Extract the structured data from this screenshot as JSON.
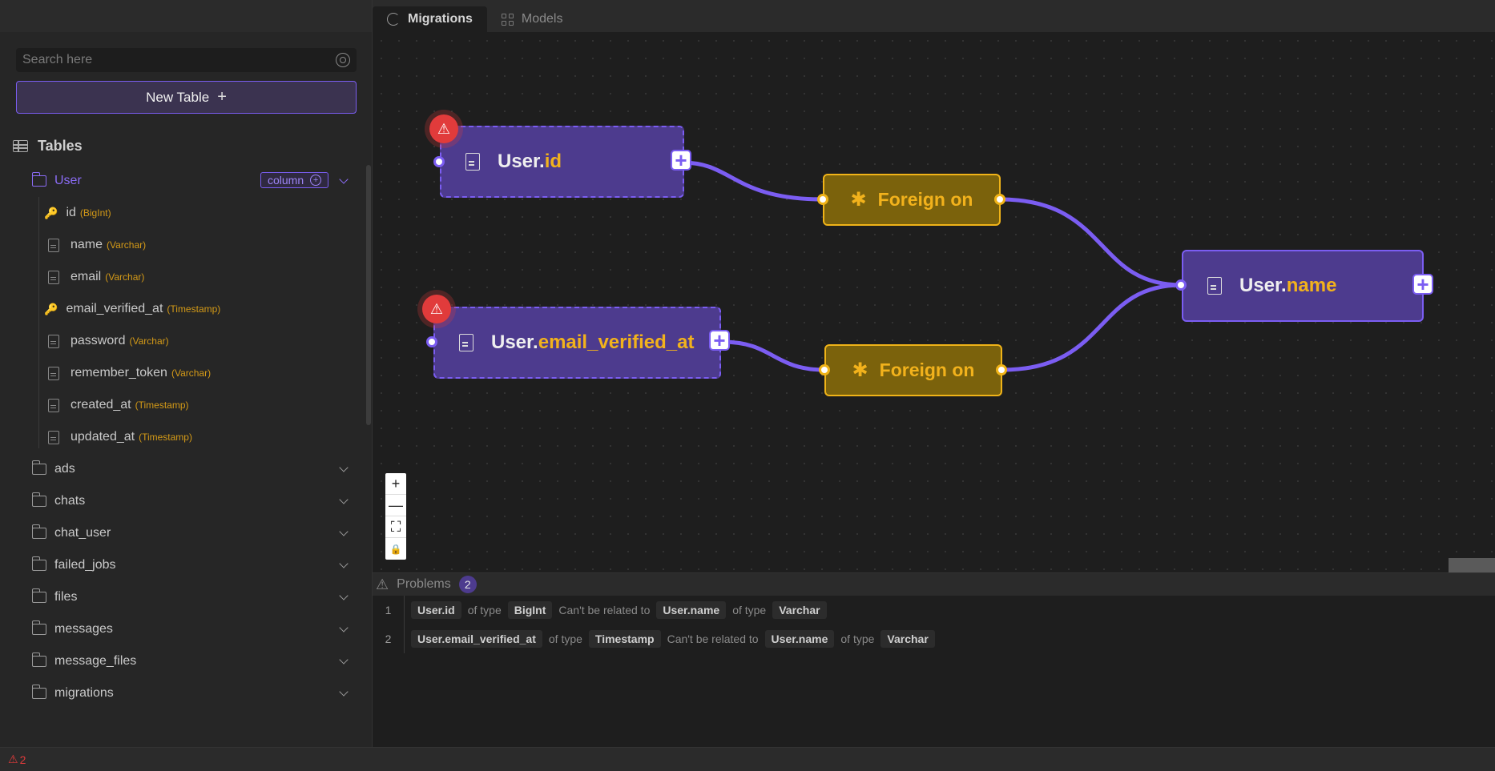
{
  "sidebar": {
    "search_placeholder": "Search here",
    "new_table_label": "New Table",
    "tables_header": "Tables",
    "active_table": {
      "name": "User",
      "column_pill": "column",
      "columns": [
        {
          "name": "id",
          "type": "(BigInt)",
          "icon": "key-icon-gold"
        },
        {
          "name": "name",
          "type": "(Varchar)",
          "icon": "document-icon"
        },
        {
          "name": "email",
          "type": "(Varchar)",
          "icon": "document-icon"
        },
        {
          "name": "email_verified_at",
          "type": "(Timestamp)",
          "icon": "key-icon-purple"
        },
        {
          "name": "password",
          "type": "(Varchar)",
          "icon": "document-icon"
        },
        {
          "name": "remember_token",
          "type": "(Varchar)",
          "icon": "document-icon"
        },
        {
          "name": "created_at",
          "type": "(Timestamp)",
          "icon": "document-icon"
        },
        {
          "name": "updated_at",
          "type": "(Timestamp)",
          "icon": "document-icon"
        }
      ]
    },
    "tables": [
      "ads",
      "chats",
      "chat_user",
      "failed_jobs",
      "files",
      "messages",
      "message_files",
      "migrations"
    ]
  },
  "tabs": [
    {
      "label": "Migrations",
      "active": true,
      "icon": "refresh-icon"
    },
    {
      "label": "Models",
      "active": false,
      "icon": "grid-icon"
    }
  ],
  "canvas": {
    "nodes": {
      "user_id": {
        "prefix": "User.",
        "field": "id"
      },
      "user_email_verified_at": {
        "prefix": "User.",
        "field": "email_verified_at"
      },
      "user_name": {
        "prefix": "User.",
        "field": "name"
      },
      "foreign_1": {
        "label": "Foreign on"
      },
      "foreign_2": {
        "label": "Foreign on"
      }
    },
    "warning_icon": "warning-triangle-icon",
    "edge_color": "#7b5df2",
    "field_node_color": "#4d3b8e",
    "foreign_node_color": "#7b620c",
    "accent_color": "#f2b21c"
  },
  "zoom_controls": [
    "zoom-in",
    "zoom-out",
    "fit-view",
    "lock"
  ],
  "problems": {
    "title": "Problems",
    "count": "2",
    "rows": [
      {
        "num": "1",
        "a": "User.id",
        "of1": "of type",
        "type_a": "BigInt",
        "mid": "Can't be related to",
        "b": "User.name",
        "of2": "of type",
        "type_b": "Varchar"
      },
      {
        "num": "2",
        "a": "User.email_verified_at",
        "of1": "of type",
        "type_a": "Timestamp",
        "mid": "Can't be related to",
        "b": "User.name",
        "of2": "of type",
        "type_b": "Varchar"
      }
    ]
  },
  "statusbar": {
    "problem_count": "2"
  }
}
